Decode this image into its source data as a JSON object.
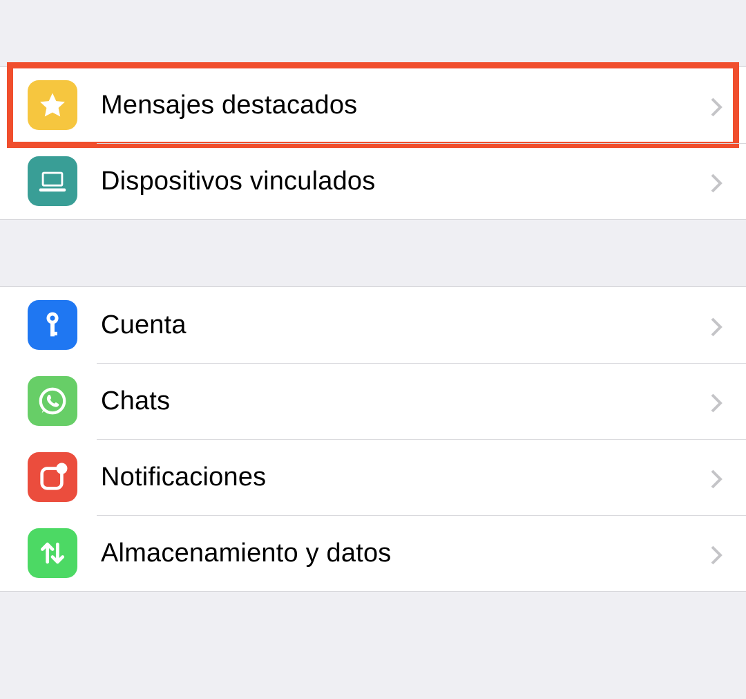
{
  "group1": {
    "starred": {
      "label": "Mensajes destacados",
      "icon_color": "#f6c63f",
      "highlighted": true
    },
    "linked": {
      "label": "Dispositivos vinculados",
      "icon_color": "#399e96"
    }
  },
  "group2": {
    "account": {
      "label": "Cuenta",
      "icon_color": "#1f77f2"
    },
    "chats": {
      "label": "Chats",
      "icon_color": "#67ce67"
    },
    "notifications": {
      "label": "Notificaciones",
      "icon_color": "#eb4d3d"
    },
    "storage": {
      "label": "Almacenamiento y datos",
      "icon_color": "#4cd964"
    }
  }
}
